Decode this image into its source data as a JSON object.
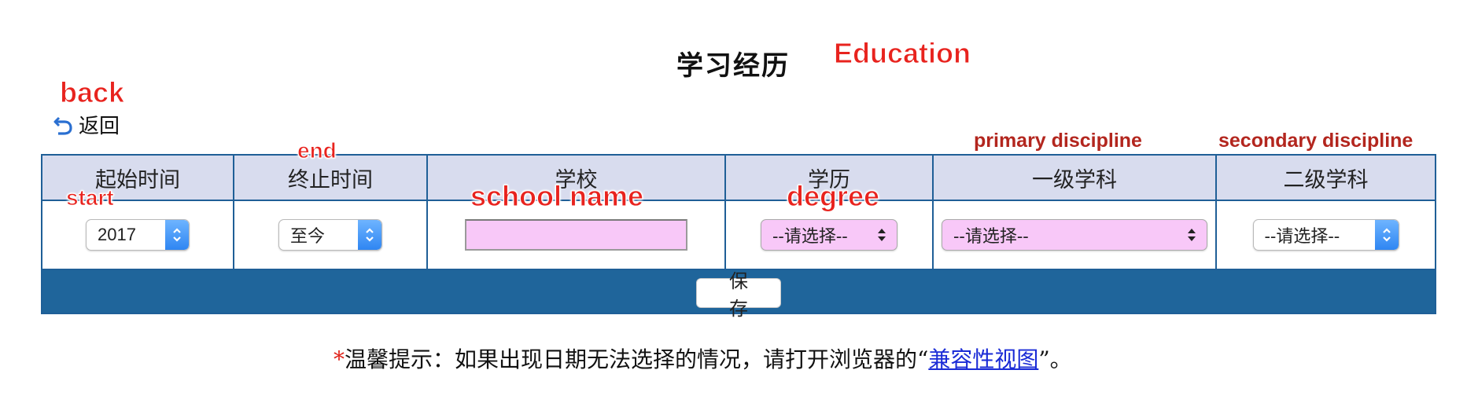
{
  "header": {
    "title": "学习经历",
    "title_annotation": "Education"
  },
  "back": {
    "label": "返回",
    "annotation": "back"
  },
  "table": {
    "columns": [
      {
        "label": "起始时间",
        "annotation": "start"
      },
      {
        "label": "终止时间",
        "annotation": "end"
      },
      {
        "label": "学校",
        "annotation": "school name"
      },
      {
        "label": "学历",
        "annotation": "degree"
      },
      {
        "label": "一级学科",
        "annotation": "primary discipline"
      },
      {
        "label": "二级学科",
        "annotation": "secondary discipline"
      }
    ],
    "row": {
      "start_value": "2017",
      "end_value": "至今",
      "school_value": "",
      "degree_value": "--请选择--",
      "primary_value": "--请选择--",
      "secondary_value": "--请选择--"
    },
    "save_label": "保 存"
  },
  "tip": {
    "star": "*",
    "text": "温馨提示：如果出现日期无法选择的情况，请打开浏览器的“",
    "link": "兼容性视图",
    "suffix": "”。"
  },
  "colors": {
    "header_bg": "#d8dcee",
    "border": "#1f5f97",
    "save_bar": "#1f659b",
    "highlight_field": "#f8c8f8",
    "annotation": "#e8231e",
    "link": "#1a2bd6"
  }
}
